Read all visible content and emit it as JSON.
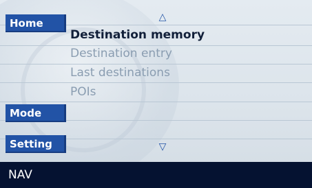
{
  "side_buttons": {
    "home_label": "Home",
    "mode_label": "Mode",
    "setting_label": "Setting"
  },
  "menu": {
    "up_arrow": "△",
    "down_arrow": "▽",
    "items": [
      {
        "label": "Destination memory",
        "state": "selected"
      },
      {
        "label": "Destination entry",
        "state": "inactive"
      },
      {
        "label": "Last destinations",
        "state": "inactive"
      },
      {
        "label": "POIs",
        "state": "inactive"
      }
    ]
  },
  "status_bar": {
    "label": "NAV"
  },
  "colors": {
    "button_blue": "#2253a6",
    "status_bar": "#051231",
    "background": "#dde5ec",
    "selected_text": "#12203a",
    "inactive_text": "#8a9db1"
  }
}
